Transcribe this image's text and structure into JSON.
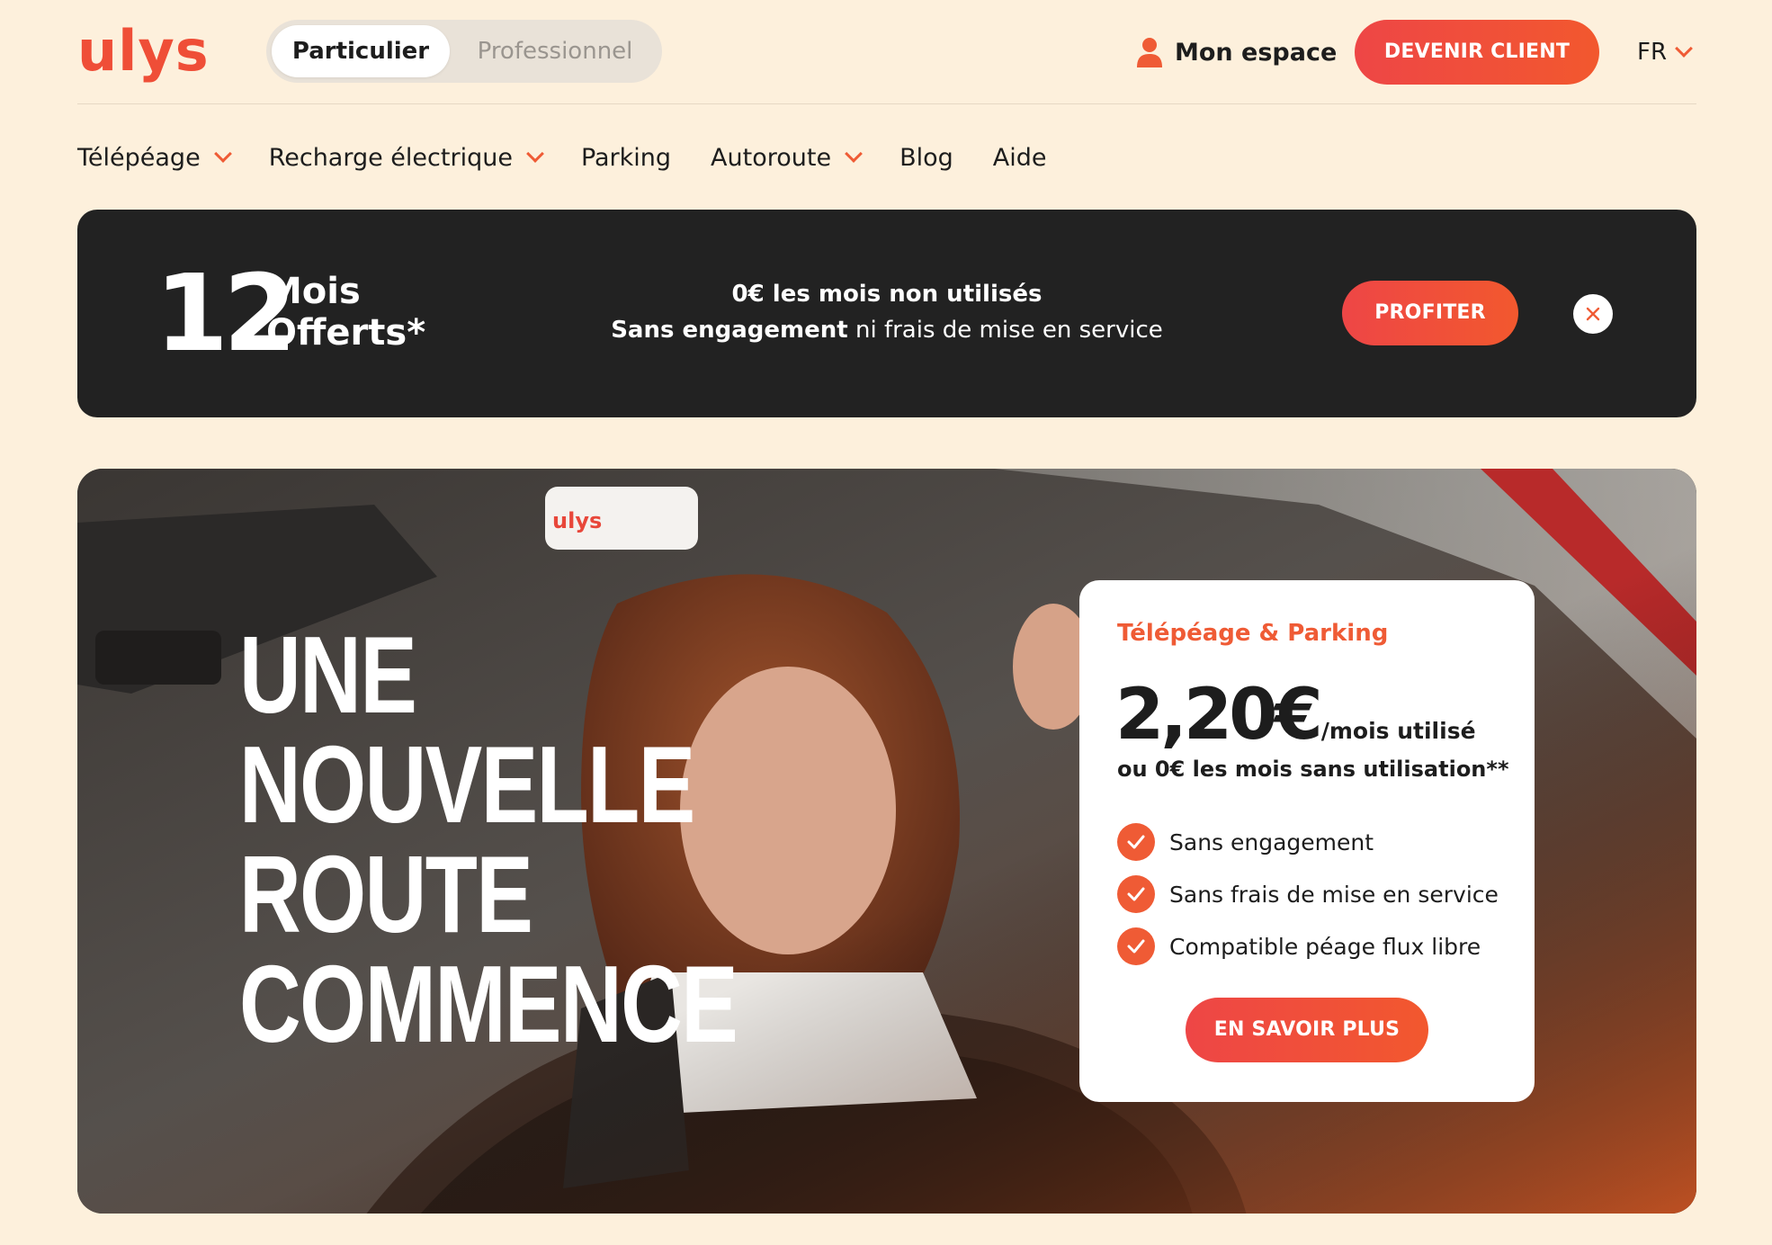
{
  "header": {
    "logo_text": "ulys",
    "segment": {
      "active": "Particulier",
      "inactive": "Professionnel"
    },
    "account_label": "Mon espace",
    "cta_label": "DEVENIR CLIENT",
    "language": "FR"
  },
  "nav": {
    "items": [
      {
        "label": "Télépéage",
        "has_dropdown": true
      },
      {
        "label": "Recharge électrique",
        "has_dropdown": true
      },
      {
        "label": "Parking",
        "has_dropdown": false
      },
      {
        "label": "Autoroute",
        "has_dropdown": true
      },
      {
        "label": "Blog",
        "has_dropdown": false
      },
      {
        "label": "Aide",
        "has_dropdown": false
      }
    ]
  },
  "promo": {
    "number": "12",
    "mois": "Mois",
    "offerts": "Offerts*",
    "line1": "0€ les mois non utilisés",
    "line2_bold": "Sans engagement",
    "line2_rest": " ni frais de mise en service",
    "cta_label": "PROFITER"
  },
  "hero": {
    "title_lines": [
      "UNE",
      "NOUVELLE",
      "ROUTE",
      "COMMENCE"
    ],
    "badge_logo": "ulys",
    "card": {
      "label": "Télépéage & Parking",
      "price": "2,20€",
      "price_unit": "/mois utilisé",
      "sub": "ou 0€ les mois sans utilisation**",
      "features": [
        "Sans engagement",
        "Sans frais de mise en service",
        "Compatible péage flux libre"
      ],
      "cta_label": "EN SAVOIR PLUS"
    }
  },
  "colors": {
    "background": "#fdf0dc",
    "brand": "#ef5b35",
    "cta_start": "#ee4646",
    "cta_end": "#f2582e",
    "banner": "#222222"
  }
}
